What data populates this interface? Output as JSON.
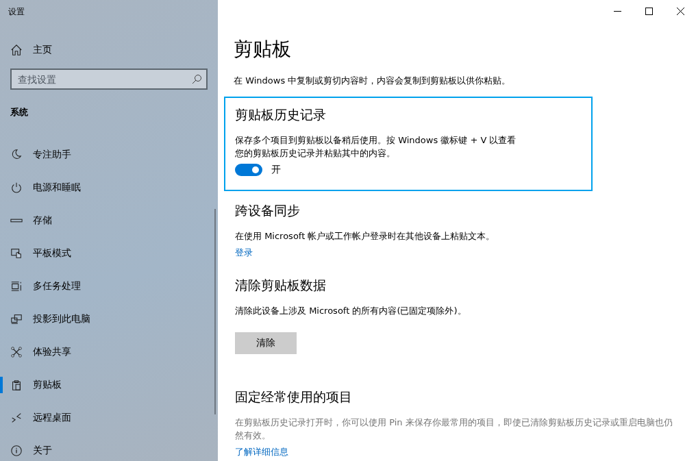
{
  "window": {
    "title": "设置"
  },
  "sidebar": {
    "home": "主页",
    "search": {
      "placeholder": "查找设置"
    },
    "section": "系统",
    "items": [
      {
        "label": "专注助手",
        "selected": false
      },
      {
        "label": "电源和睡眠",
        "selected": false
      },
      {
        "label": "存储",
        "selected": false
      },
      {
        "label": "平板模式",
        "selected": false
      },
      {
        "label": "多任务处理",
        "selected": false
      },
      {
        "label": "投影到此电脑",
        "selected": false
      },
      {
        "label": "体验共享",
        "selected": false
      },
      {
        "label": "剪贴板",
        "selected": true
      },
      {
        "label": "远程桌面",
        "selected": false
      },
      {
        "label": "关于",
        "selected": false
      }
    ]
  },
  "page": {
    "title": "剪贴板",
    "description": "在 Windows 中复制或剪切内容时，内容会复制到剪贴板以供你粘贴。",
    "sections": [
      {
        "kind": "toggle",
        "heading": "剪贴板历史记录",
        "focused": true,
        "description": "保存多个项目到剪贴板以备稍后使用。按 Windows 徽标键 + V 以查看您的剪贴板历史记录并粘贴其中的内容。",
        "on": true,
        "state_label": "开"
      },
      {
        "kind": "link",
        "heading": "跨设备同步",
        "focused": false,
        "description": "在使用 Microsoft 帐户或工作帐户登录时在其他设备上粘贴文本。",
        "link": "登录"
      },
      {
        "kind": "button",
        "heading": "清除剪贴板数据",
        "focused": false,
        "description": "清除此设备上涉及 Microsoft 的所有内容(已固定项除外)。",
        "button": "清除"
      },
      {
        "kind": "link",
        "heading": "固定经常使用的项目",
        "focused": false,
        "disabled": true,
        "description": "在剪贴板历史记录打开时，你可以使用 Pin 来保存你最常用的项目，即使已清除剪贴板历史记录或重启电脑也仍然有效。",
        "link": "了解详细信息"
      }
    ]
  }
}
